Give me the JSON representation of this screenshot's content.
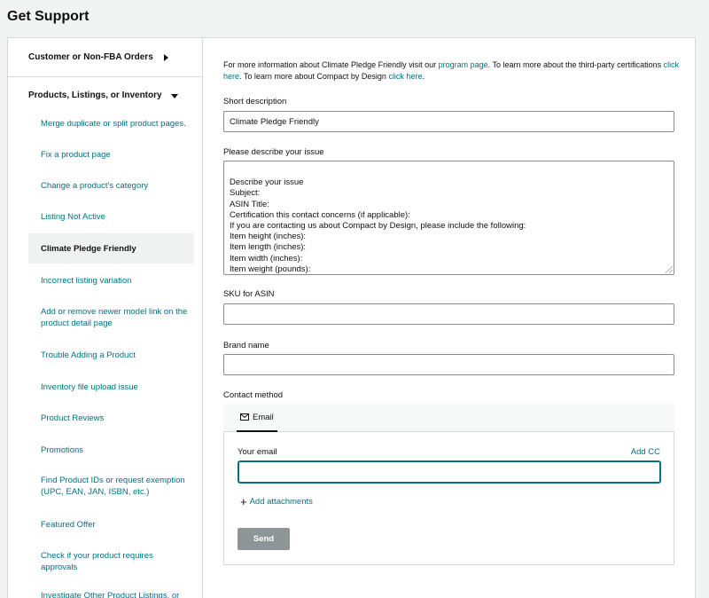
{
  "page_title": "Get Support",
  "sidebar": {
    "section1": "Customer or Non-FBA Orders",
    "section2": "Products, Listings, or Inventory",
    "items": [
      {
        "label": "Merge duplicate or split product pages."
      },
      {
        "label": "Fix a product page"
      },
      {
        "label": "Change a product's category"
      },
      {
        "label": "Listing Not Active"
      },
      {
        "label": "Climate Pledge Friendly"
      },
      {
        "label": "Incorrect listing variation"
      },
      {
        "label": "Add or remove newer model link on the product detail page"
      },
      {
        "label": "Trouble Adding a Product"
      },
      {
        "label": "Inventory file upload issue"
      },
      {
        "label": "Product Reviews"
      },
      {
        "label": "Promotions"
      },
      {
        "label": "Find Product IDs or request exemption (UPC, EAN, JAN, ISBN, etc.)"
      },
      {
        "label": "Featured Offer"
      },
      {
        "label": "Check if your product requires approvals"
      },
      {
        "label": "Investigate Other Product Listings, or"
      }
    ]
  },
  "info": {
    "t1": "For more information about Climate Pledge Friendly visit our ",
    "l1": "program page",
    "t2": ". To learn more about the third-party certifications ",
    "l2": "click here",
    "t3": ". To learn more about Compact by Design ",
    "l3": "click here",
    "t4": "."
  },
  "form": {
    "short_desc_label": "Short description",
    "short_desc_value": "Climate Pledge Friendly",
    "issue_label": "Please describe your issue",
    "issue_value": "Describe your issue\nSubject:\nASIN Title:\nCertification this contact concerns (if applicable):\nIf you are contacting us about Compact by Design, please include the following:\nItem height (inches):\nItem length (inches):\nItem width (inches):\nItem weight (pounds):",
    "sku_label": "SKU for ASIN",
    "sku_value": "",
    "brand_label": "Brand name",
    "brand_value": "",
    "contact_label": "Contact method",
    "tab_email": "Email",
    "your_email_label": "Your email",
    "add_cc": "Add CC",
    "email_value": "",
    "add_attachments": "Add attachments",
    "send": "Send"
  },
  "colors": {
    "link": "#007185",
    "send_disabled": "#8d9696"
  }
}
